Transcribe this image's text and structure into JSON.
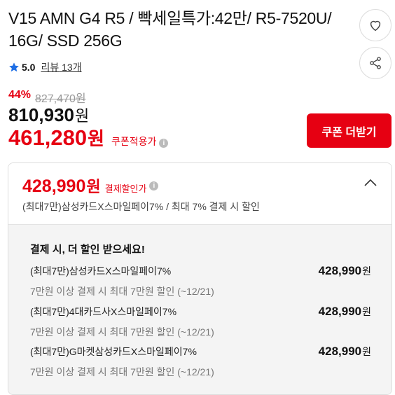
{
  "product": {
    "title": "V15 AMN G4 R5 / 빡세일특가:42만/ R5-7520U/ 16G/ SSD 256G",
    "rating": "5.0",
    "review_label": "리뷰",
    "review_count": "13개"
  },
  "pricing": {
    "discount_pct": "44%",
    "original_price": "827,470원",
    "price": "810,930",
    "price_unit": "원",
    "coupon_price": "461,280",
    "coupon_unit": "원",
    "coupon_label": "쿠폰적용가",
    "coupon_button": "쿠폰 더받기"
  },
  "payment_card": {
    "price": "428,990",
    "unit": "원",
    "label": "결제할인가",
    "summary": "(최대7만)삼성카드X스마일페이7% / 최대 7% 결제 시 할인",
    "heading": "결제 시, 더 할인 받으세요!",
    "promos": [
      {
        "name": "(최대7만)삼성카드X스마일페이7%",
        "desc": "7만원 이상 결제 시 최대 7만원 할인 (~12/21)",
        "price": "428,990",
        "unit": "원"
      },
      {
        "name": "(최대7만)4대카드사X스마일페이7%",
        "desc": "7만원 이상 결제 시 최대 7만원 할인 (~12/21)",
        "price": "428,990",
        "unit": "원"
      },
      {
        "name": "(최대7만)G마켓삼성카드X스마일페이7%",
        "desc": "7만원 이상 결제 시 최대 7만원 할인 (~12/21)",
        "price": "428,990",
        "unit": "원"
      }
    ]
  },
  "icons": {
    "heart": "heart-icon",
    "share": "share-icon",
    "star": "star-icon",
    "info": "info-icon",
    "chevron": "chevron-up-icon"
  },
  "colors": {
    "accent": "#e60012",
    "star": "#1f6fe5"
  }
}
